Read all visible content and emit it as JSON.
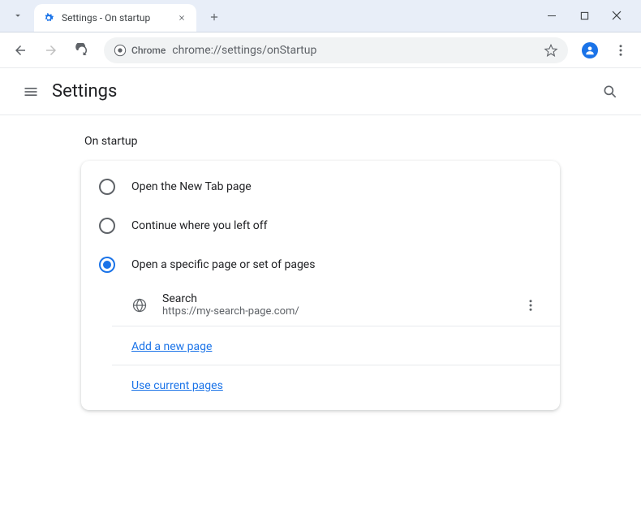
{
  "tab": {
    "title": "Settings - On startup"
  },
  "omnibox": {
    "label": "Chrome",
    "url": "chrome://settings/onStartup"
  },
  "header": {
    "title": "Settings"
  },
  "section": {
    "title": "On startup",
    "options": [
      {
        "label": "Open the New Tab page"
      },
      {
        "label": "Continue where you left off"
      },
      {
        "label": "Open a specific page or set of pages"
      }
    ],
    "pages": [
      {
        "name": "Search",
        "url": "https://my-search-page.com/"
      }
    ],
    "add_link": "Add a new page",
    "current_link": "Use current pages"
  }
}
